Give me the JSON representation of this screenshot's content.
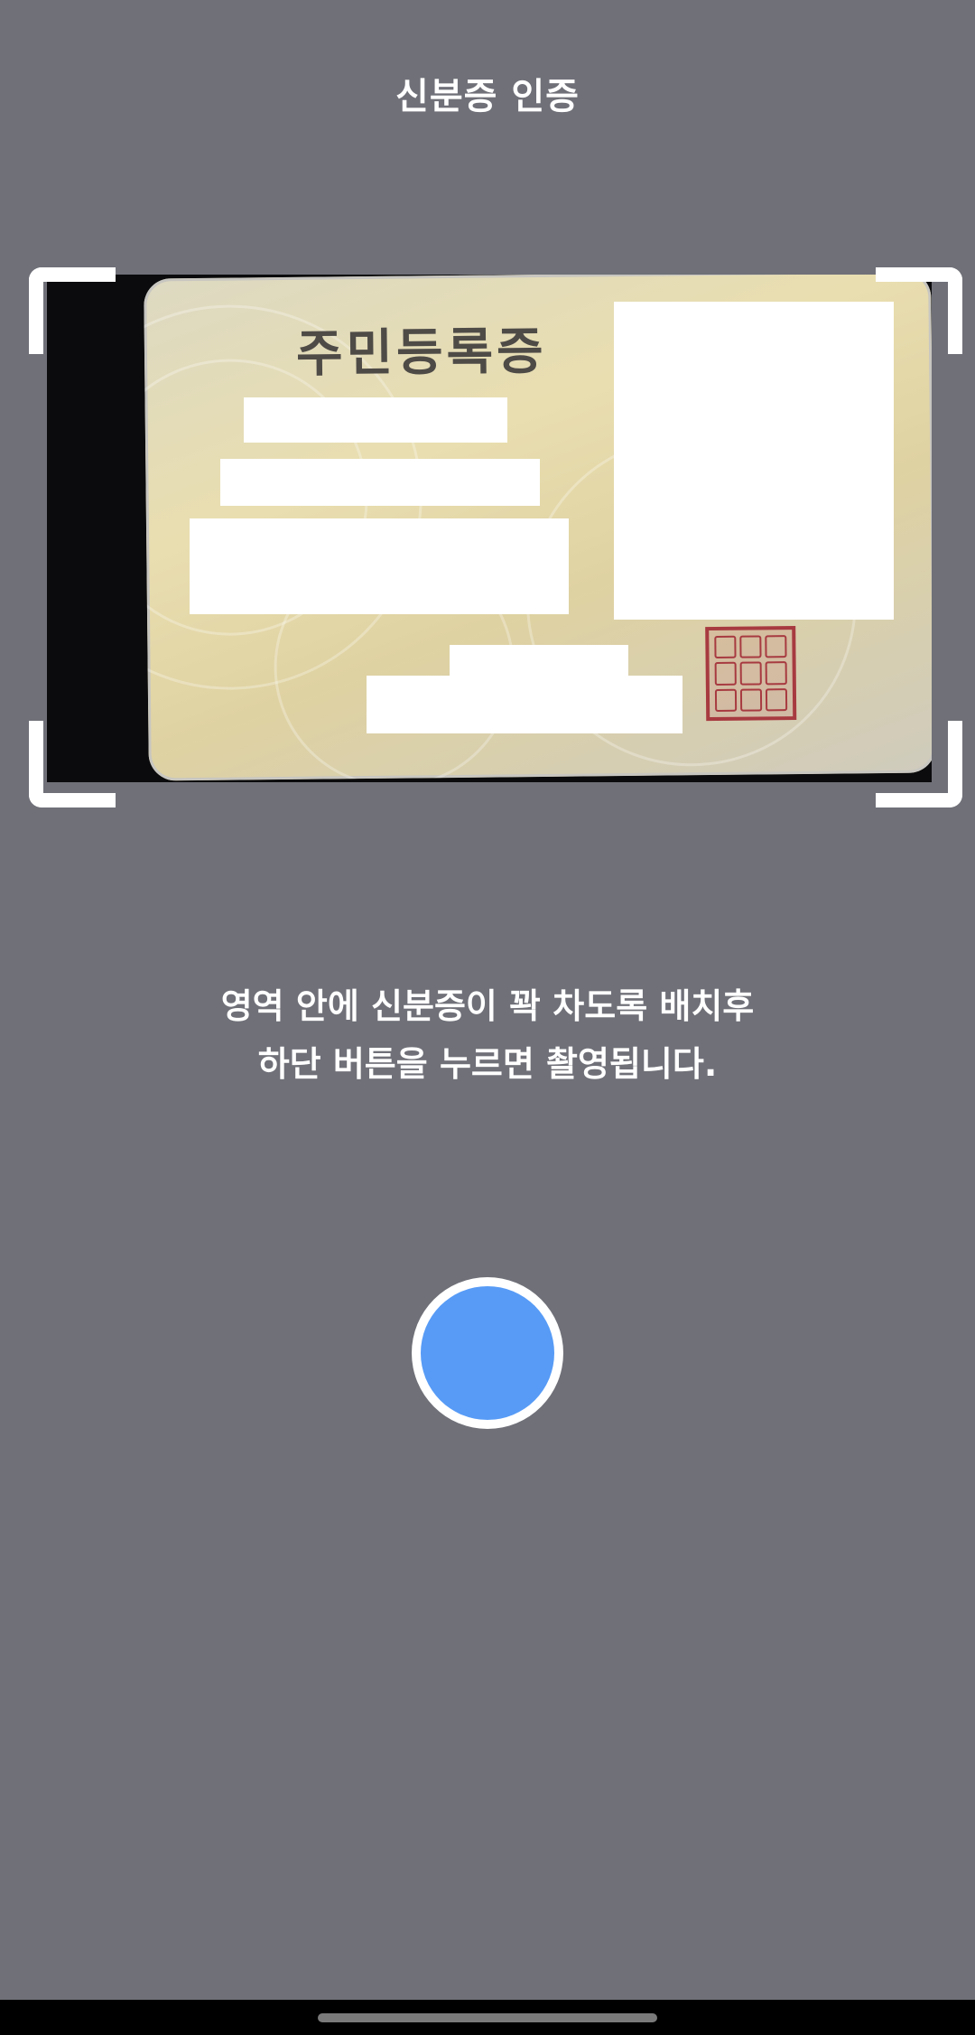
{
  "header": {
    "title": "신분증 인증"
  },
  "preview": {
    "card_title": "주민등록증"
  },
  "instructions": {
    "line1": "영역 안에 신분증이 꽉 차도록 배치후",
    "line2": "하단 버튼을 누르면 촬영됩니다."
  },
  "colors": {
    "background": "#6f7078",
    "shutter": "#579bf6",
    "bracket": "#ffffff"
  }
}
